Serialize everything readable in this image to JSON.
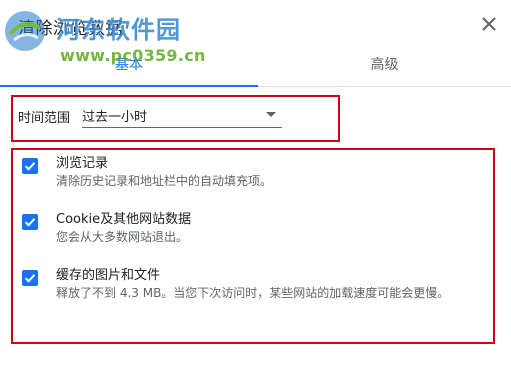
{
  "dialog": {
    "title": "清除浏览数据"
  },
  "watermark": {
    "site_name": "河东软件园",
    "url": "www.pc0359.cn"
  },
  "tabs": [
    {
      "label": "基本",
      "active": true
    },
    {
      "label": "高级",
      "active": false
    }
  ],
  "time_range": {
    "label": "时间范围",
    "selected": "过去一小时"
  },
  "options": [
    {
      "title": "浏览记录",
      "description": "清除历史记录和地址栏中的自动填充项。",
      "checked": true
    },
    {
      "title": "Cookie及其他网站数据",
      "description": "您会从大多数网站退出。",
      "checked": true
    },
    {
      "title": "缓存的图片和文件",
      "description": "释放了不到 4.3 MB。当您下次访问时，某些网站的加载速度可能会更慢。",
      "checked": true
    }
  ],
  "colors": {
    "accent": "#1a73e8",
    "highlight_border": "#d0021b",
    "text_secondary": "#5f6368"
  },
  "icons": {
    "close": "close-icon",
    "checkbox": "check-icon",
    "dropdown": "triangle-down-icon"
  }
}
